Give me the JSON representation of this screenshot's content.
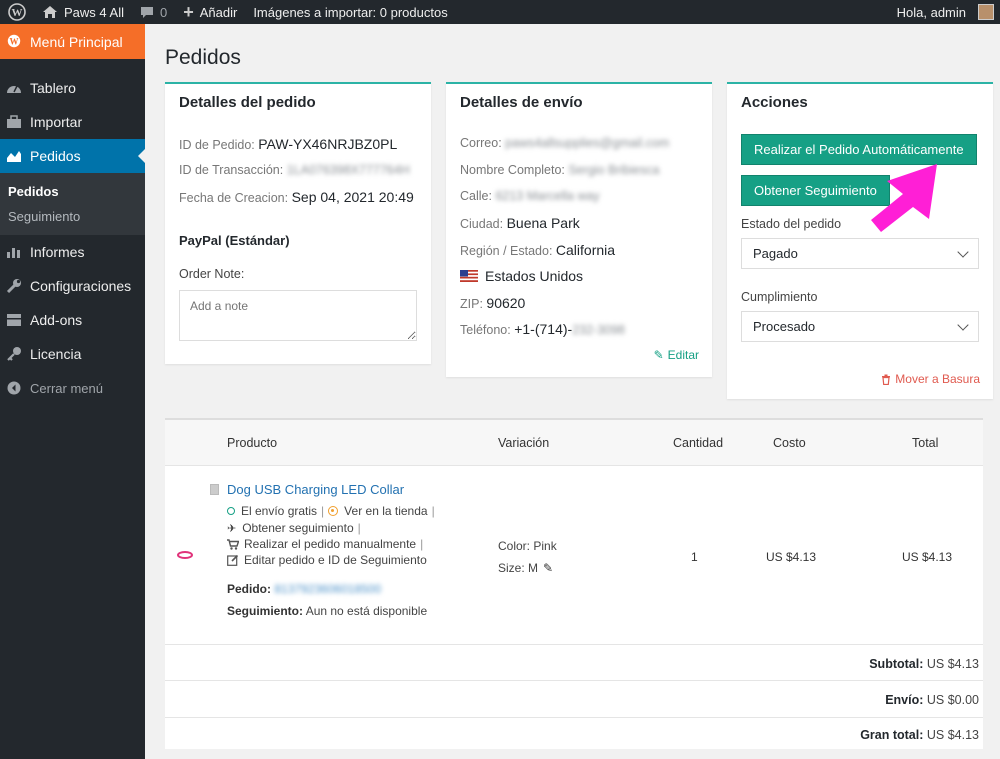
{
  "adminbar": {
    "site_name": "Paws 4 All",
    "comments_count": "0",
    "add_label": "Añadir",
    "import_status": "Imágenes a importar: 0 productos",
    "greeting": "Hola, admin"
  },
  "sidebar": {
    "main_menu": "Menú Principal",
    "items": [
      {
        "label": "Tablero",
        "icon": "dashboard-icon"
      },
      {
        "label": "Importar",
        "icon": "briefcase-icon"
      },
      {
        "label": "Pedidos",
        "icon": "chart-area-icon"
      },
      {
        "label": "Informes",
        "icon": "bar-chart-icon"
      },
      {
        "label": "Configuraciones",
        "icon": "wrench-icon"
      },
      {
        "label": "Add-ons",
        "icon": "stack-icon"
      },
      {
        "label": "Licencia",
        "icon": "key-icon"
      }
    ],
    "submenu": [
      "Pedidos",
      "Seguimiento"
    ],
    "collapse": "Cerrar menú"
  },
  "page": {
    "title": "Pedidos"
  },
  "order_details": {
    "title": "Detalles del pedido",
    "order_id_label": "ID de Pedido:",
    "order_id": "PAW-YX46NRJBZ0PL",
    "transaction_label": "ID de Transacción:",
    "transaction_id": "1LA076398X777764H",
    "date_label": "Fecha de Creacion:",
    "date": "Sep 04, 2021 20:49",
    "payment_method": "PayPal (Estándar)",
    "note_label": "Order Note:",
    "note_placeholder": "Add a note"
  },
  "shipping": {
    "title": "Detalles de envío",
    "email_label": "Correo:",
    "email": "paws4allsupplies@gmail.com",
    "name_label": "Nombre Completo:",
    "name": "Sergio Bribiesca",
    "street_label": "Calle:",
    "street": "6213 Marcella way",
    "city_label": "Ciudad:",
    "city": "Buena Park",
    "region_label": "Región / Estado:",
    "region": "California",
    "country": "Estados Unidos",
    "zip_label": "ZIP:",
    "zip": "90620",
    "phone_label": "Teléfono:",
    "phone_visible": "+1-(714)-",
    "phone_hidden": "232-3098",
    "edit": "Editar"
  },
  "actions": {
    "title": "Acciones",
    "auto_order": "Realizar el Pedido Automáticamente",
    "get_tracking": "Obtener Seguimiento",
    "status_label": "Estado del pedido",
    "status_value": "Pagado",
    "fulfillment_label": "Cumplimiento",
    "fulfillment_value": "Procesado",
    "trash": "Mover a Basura",
    "accent": "#16a085"
  },
  "table": {
    "headers": {
      "product": "Producto",
      "variation": "Variación",
      "quantity": "Cantidad",
      "cost": "Costo",
      "total": "Total"
    },
    "item": {
      "name": "Dog USB Charging LED Collar",
      "free_shipping": "El envío gratis",
      "view_store": "Ver en la tienda",
      "get_tracking": "Obtener seguimiento",
      "manual_order": "Realizar el pedido manualmente",
      "edit_order": "Editar pedido e ID de Seguimiento",
      "order_label": "Pedido:",
      "order_number": "8137923606018500",
      "tracking_label": "Seguimiento:",
      "tracking_value": "Aun no está disponible",
      "color": "Color: Pink",
      "size": "Size: M",
      "quantity": "1",
      "cost": "US $4.13",
      "total": "US $4.13"
    },
    "totals": {
      "subtotal_label": "Subtotal:",
      "subtotal": "US $4.13",
      "shipping_label": "Envío:",
      "shipping": "US $0.00",
      "grand_label": "Gran total:",
      "grand": "US $4.13"
    }
  },
  "annotation": {
    "arrow_color": "#ff1fd6"
  }
}
